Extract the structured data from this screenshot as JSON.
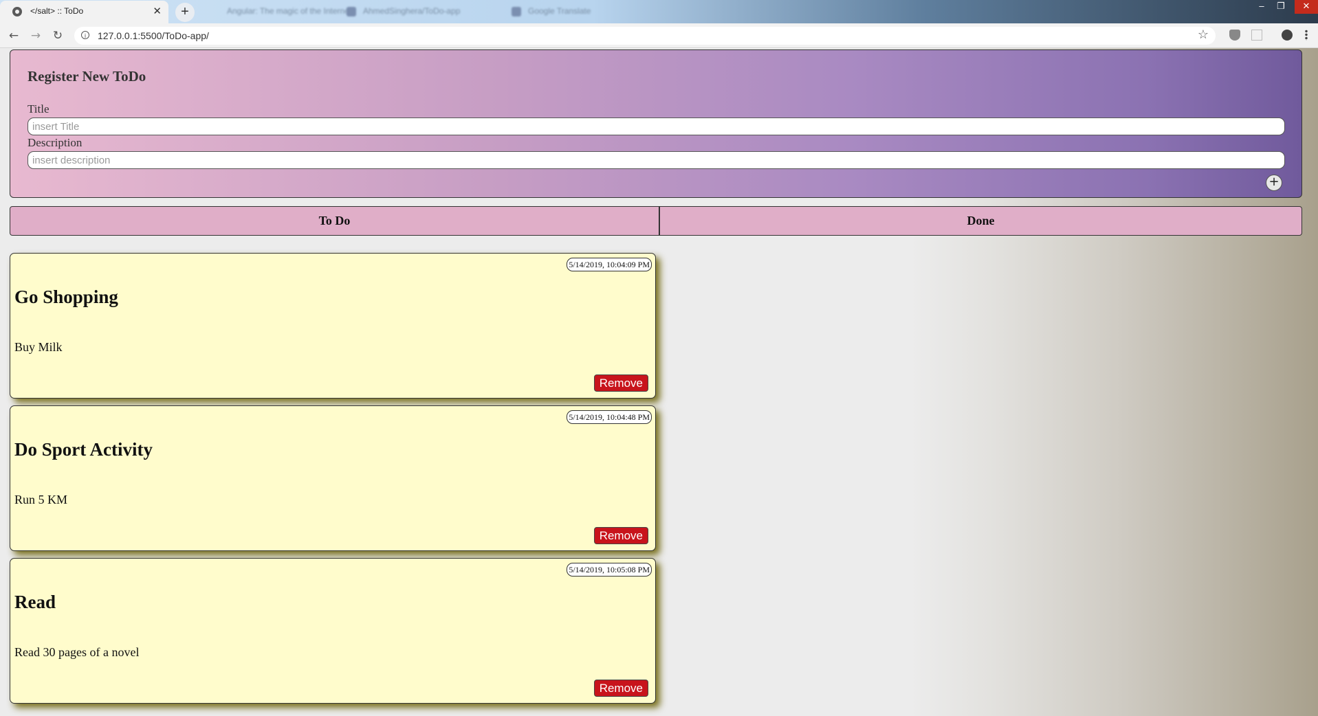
{
  "browser": {
    "active_tab": {
      "title": "</salt> :: ToDo",
      "close": "✕"
    },
    "background_tabs": [
      {
        "title": "Angular: The magic of the Internet"
      },
      {
        "title": "AhmedSinghera/ToDo-app"
      },
      {
        "title": "Google Translate"
      }
    ],
    "new_tab": "+",
    "window_controls": [
      "–",
      "❐",
      "✕"
    ],
    "url": "127.0.0.1:5500/ToDo-app/",
    "nav": {
      "back": "←",
      "forward": "→",
      "reload": "↻"
    },
    "star": "☆"
  },
  "register": {
    "heading": "Register New ToDo",
    "title_label": "Title",
    "title_placeholder": "insert Title",
    "title_value": "",
    "desc_label": "Description",
    "desc_placeholder": "insert description",
    "desc_value": "",
    "add_button": "+"
  },
  "columns": {
    "todo": "To Do",
    "done": "Done"
  },
  "todos": [
    {
      "timestamp": "5/14/2019, 10:04:09 PM",
      "title": "Go Shopping",
      "description": "Buy Milk",
      "remove": "Remove"
    },
    {
      "timestamp": "5/14/2019, 10:04:48 PM",
      "title": "Do Sport Activity",
      "description": "Run 5 KM",
      "remove": "Remove"
    },
    {
      "timestamp": "5/14/2019, 10:05:08 PM",
      "title": "Read",
      "description": "Read 30 pages of a novel",
      "remove": "Remove"
    }
  ],
  "colors": {
    "register_gradient_start": "#e8b9d0",
    "register_gradient_end": "#705a9c",
    "tab_bar": "#e0aec8",
    "card_background": "#fffccc",
    "remove_button": "#c8141c"
  }
}
